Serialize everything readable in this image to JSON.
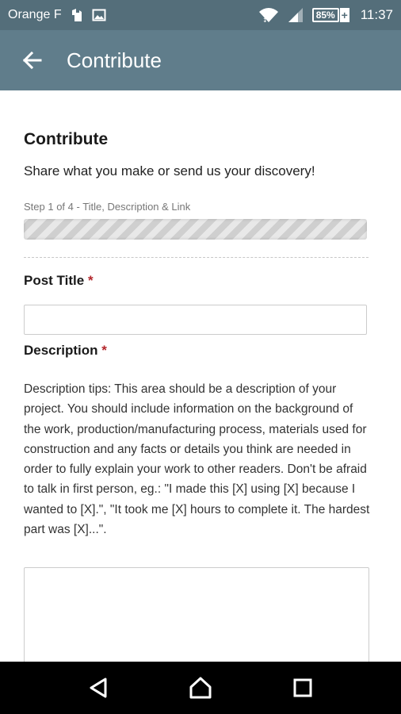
{
  "status_bar": {
    "carrier": "Orange F",
    "battery_percent": "85%",
    "battery_charging_symbol": "+",
    "time": "11:37",
    "icons": [
      "notification-icon",
      "image-icon",
      "wifi-icon",
      "signal-icon",
      "battery-icon"
    ]
  },
  "app_bar": {
    "title": "Contribute",
    "back_icon": "arrow-left-icon",
    "background_color": "#607d8b"
  },
  "form": {
    "heading": "Contribute",
    "subtitle": "Share what you make or send us your discovery!",
    "step_label": "Step 1 of 4 - Title, Description & Link",
    "progress_fraction": 0.25,
    "post_title": {
      "label": "Post Title",
      "required_mark": "*",
      "value": "",
      "placeholder": ""
    },
    "description": {
      "label": "Description",
      "required_mark": "*",
      "tips": "Description tips: This area should be a description of your project. You should include information on the background of the work, production/manufacturing process, materials used for construction and any facts or details you think are needed in order to fully explain your work to other readers. Don't be afraid to talk in first person, eg.: \"I made this [X] using [X] because I wanted to [X].\", \"It took me [X] hours to complete it. The hardest part was [X]...\".",
      "value": "",
      "placeholder": ""
    }
  },
  "nav_bar": {
    "buttons": [
      "back-triangle-icon",
      "home-icon",
      "recents-icon"
    ]
  },
  "colors": {
    "required": "#b3262b",
    "status_bar": "#546e7a",
    "app_bar": "#607d8b"
  }
}
